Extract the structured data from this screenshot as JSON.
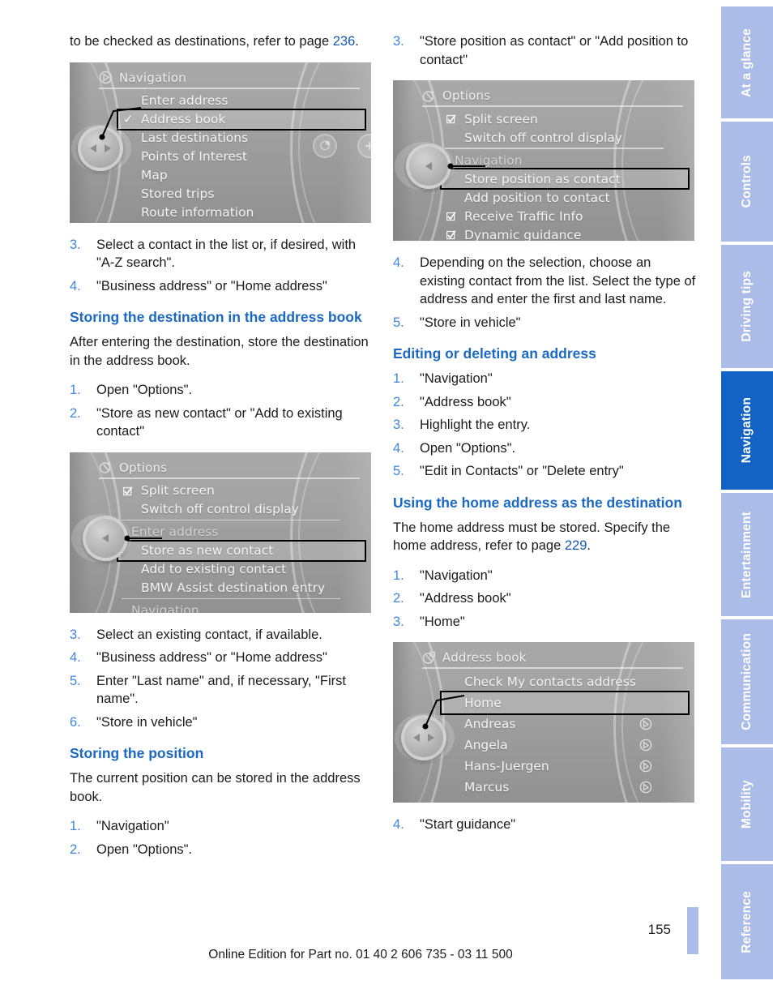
{
  "document": {
    "page_number": "155",
    "footer": "Online Edition for Part no. 01 40 2 606 735 - 03 11 500"
  },
  "left_column": {
    "intro": {
      "text_before": "to be checked as destinations, refer to page ",
      "page_ref": "236",
      "text_after": "."
    },
    "screen_navigation": {
      "title": "Navigation",
      "header_icon": "navigation-arrow-icon",
      "items": [
        {
          "label": "Enter address",
          "state": "normal"
        },
        {
          "label": "Address book",
          "state": "selected",
          "marker": "check"
        },
        {
          "label": "Last destinations",
          "state": "normal"
        },
        {
          "label": "Points of Interest",
          "state": "normal"
        },
        {
          "label": "Map",
          "state": "normal"
        },
        {
          "label": "Stored trips",
          "state": "normal"
        },
        {
          "label": "Route information",
          "state": "normal"
        }
      ]
    },
    "steps_a": [
      {
        "num": "3.",
        "text": "Select a contact in the list or, if desired, with \"A-Z search\"."
      },
      {
        "num": "4.",
        "text": "\"Business address\" or \"Home address\""
      }
    ],
    "heading_1": "Storing the destination in the address book",
    "body_1": "After entering the destination, store the destination in the address book.",
    "steps_b": [
      {
        "num": "1.",
        "text": "Open \"Options\"."
      },
      {
        "num": "2.",
        "text": "\"Store as new contact\" or \"Add to existing contact\""
      }
    ],
    "screen_options_enter_address": {
      "title": "Options",
      "header_icon": "options-star-icon",
      "items": [
        {
          "label": "Split screen",
          "state": "normal",
          "marker": "checkbox"
        },
        {
          "label": "Switch off control display",
          "state": "normal"
        },
        {
          "label": "Enter address",
          "state": "section"
        },
        {
          "label": "Store as new contact",
          "state": "selected"
        },
        {
          "label": "Add to existing contact",
          "state": "normal"
        },
        {
          "label": "BMW Assist destination entry",
          "state": "normal"
        },
        {
          "label": "Navigation",
          "state": "section"
        }
      ]
    },
    "steps_c": [
      {
        "num": "3.",
        "text": "Select an existing contact, if available."
      },
      {
        "num": "4.",
        "text": "\"Business address\" or \"Home address\""
      },
      {
        "num": "5.",
        "text": "Enter \"Last name\" and, if necessary, \"First name\"."
      },
      {
        "num": "6.",
        "text": "\"Store in vehicle\""
      }
    ],
    "heading_2": "Storing the position",
    "body_2": "The current position can be stored in the address book.",
    "steps_d": [
      {
        "num": "1.",
        "text": "\"Navigation\""
      },
      {
        "num": "2.",
        "text": "Open \"Options\"."
      }
    ]
  },
  "right_column": {
    "steps_a": [
      {
        "num": "3.",
        "text": "\"Store position as contact\" or \"Add position to contact\""
      }
    ],
    "screen_options_navigation": {
      "title": "Options",
      "header_icon": "options-star-icon",
      "items": [
        {
          "label": "Split screen",
          "state": "normal",
          "marker": "checkbox"
        },
        {
          "label": "Switch off control display",
          "state": "normal"
        },
        {
          "label": "Navigation",
          "state": "section"
        },
        {
          "label": "Store position as contact",
          "state": "selected"
        },
        {
          "label": "Add position to contact",
          "state": "normal"
        },
        {
          "label": "Receive Traffic Info",
          "state": "normal",
          "marker": "checkbox"
        },
        {
          "label": "Dynamic guidance",
          "state": "normal",
          "marker": "checkbox"
        }
      ]
    },
    "steps_b": [
      {
        "num": "4.",
        "text": "Depending on the selection, choose an existing contact from the list. Select the type of address and enter the first and last name."
      },
      {
        "num": "5.",
        "text": "\"Store in vehicle\""
      }
    ],
    "heading_1": "Editing or deleting an address",
    "steps_c": [
      {
        "num": "1.",
        "text": "\"Navigation\""
      },
      {
        "num": "2.",
        "text": "\"Address book\""
      },
      {
        "num": "3.",
        "text": "Highlight the entry."
      },
      {
        "num": "4.",
        "text": "Open \"Options\"."
      },
      {
        "num": "5.",
        "text": "\"Edit in Contacts\" or \"Delete entry\""
      }
    ],
    "heading_2": "Using the home address as the destination",
    "body_1": {
      "text_before": "The home address must be stored. Specify the home address, refer to page ",
      "page_ref": "229",
      "text_after": "."
    },
    "steps_d": [
      {
        "num": "1.",
        "text": "\"Navigation\""
      },
      {
        "num": "2.",
        "text": "\"Address book\""
      },
      {
        "num": "3.",
        "text": "\"Home\""
      }
    ],
    "screen_address_book": {
      "title": "Address book",
      "header_icon": "address-book-icon",
      "items": [
        {
          "label": "Check My contacts address",
          "state": "normal"
        },
        {
          "label": "Home",
          "state": "selected"
        },
        {
          "label": "Andreas",
          "state": "normal",
          "row_icon": "guidance-arrow-icon"
        },
        {
          "label": "Angela",
          "state": "normal",
          "row_icon": "guidance-arrow-icon"
        },
        {
          "label": "Hans-Juergen",
          "state": "normal",
          "row_icon": "guidance-arrow-icon"
        },
        {
          "label": "Marcus",
          "state": "normal",
          "row_icon": "guidance-arrow-icon"
        }
      ]
    },
    "steps_e": [
      {
        "num": "4.",
        "text": "\"Start guidance\""
      }
    ]
  },
  "rail": {
    "active_color": "#1263c4",
    "inactive_color": "#aabce7",
    "tabs": [
      {
        "label": "At a glance",
        "active": false
      },
      {
        "label": "Controls",
        "active": false
      },
      {
        "label": "Driving tips",
        "active": false
      },
      {
        "label": "Navigation",
        "active": true
      },
      {
        "label": "Entertainment",
        "active": false
      },
      {
        "label": "Communication",
        "active": false
      },
      {
        "label": "Mobility",
        "active": false
      },
      {
        "label": "Reference",
        "active": false
      }
    ]
  }
}
